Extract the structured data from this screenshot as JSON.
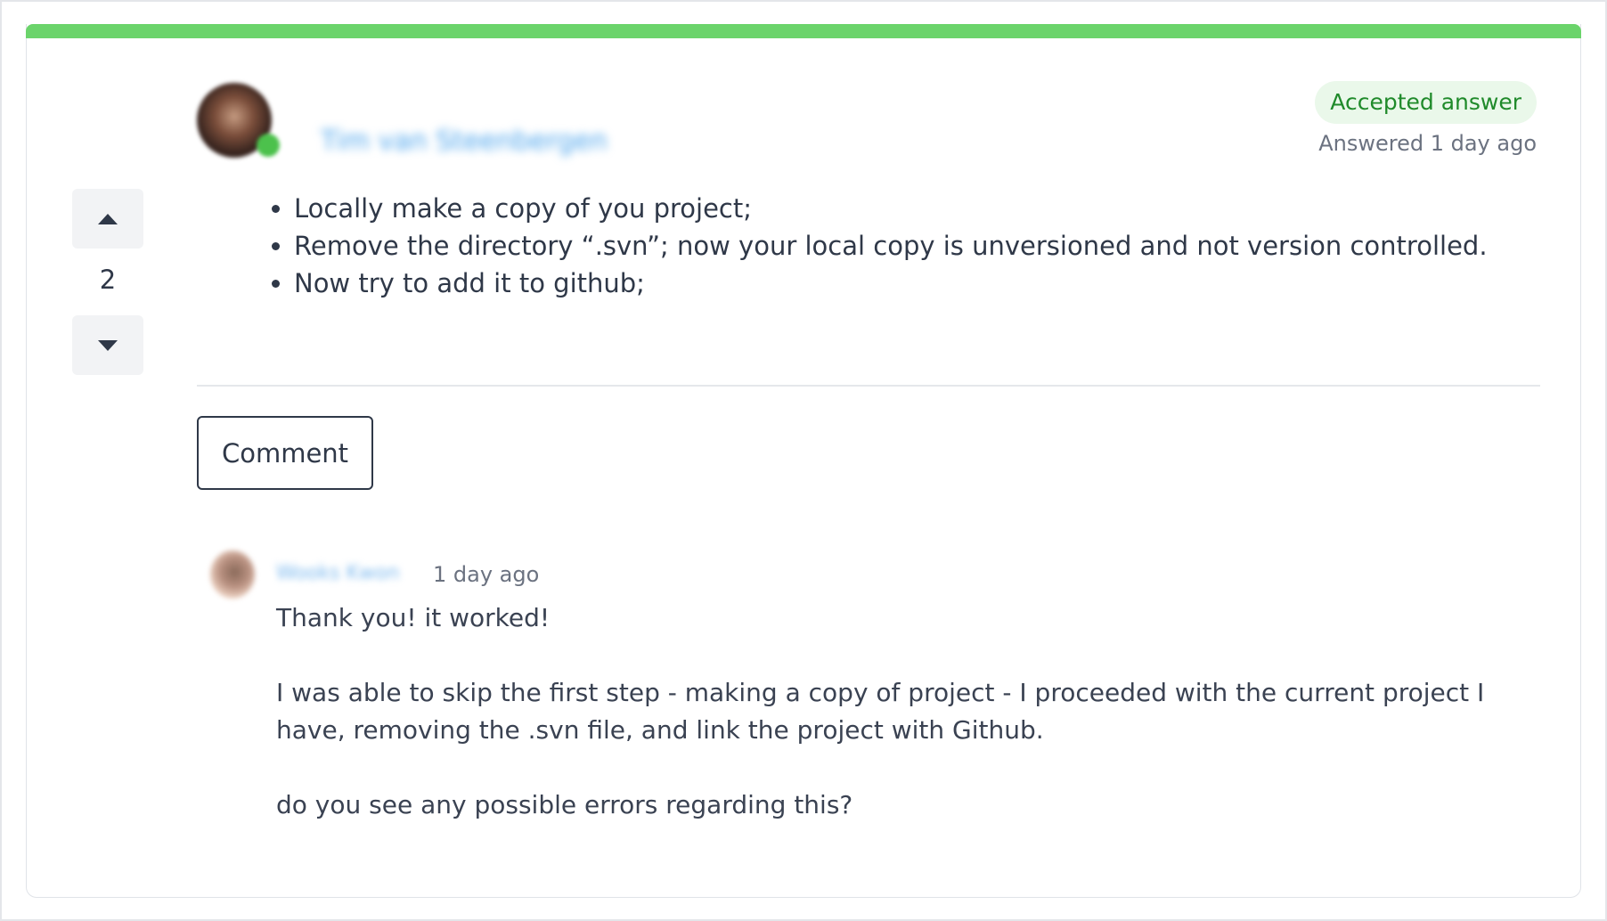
{
  "colors": {
    "accent_bar": "#6bd46b",
    "accepted_badge_bg": "#eaf8ea",
    "accepted_badge_text": "#1f8a2a",
    "author_link": "#4aa3ec",
    "online_indicator": "#4cc14c"
  },
  "vote": {
    "upvote_icon": "caret-up-icon",
    "count": "2",
    "downvote_icon": "caret-down-icon"
  },
  "answer": {
    "author_name": "Tim van Steenbergen",
    "accepted_label": "Accepted answer",
    "answered_time": "Answered 1 day ago",
    "body_items": [
      "Locally make a copy of you project;",
      "Remove the directory “.svn”; now your local copy is unversioned and not version controlled.",
      "Now try to add it to github;"
    ]
  },
  "actions": {
    "comment_label": "Comment"
  },
  "comment": {
    "author_name": "Wooks Kwon",
    "time": "1 day ago",
    "paragraphs": [
      "Thank you! it worked!",
      "I was able to skip the first step - making a copy of project - I proceeded with the current project I have, removing the .svn file, and link the project with Github.",
      "do you see any possible errors regarding this?"
    ]
  }
}
